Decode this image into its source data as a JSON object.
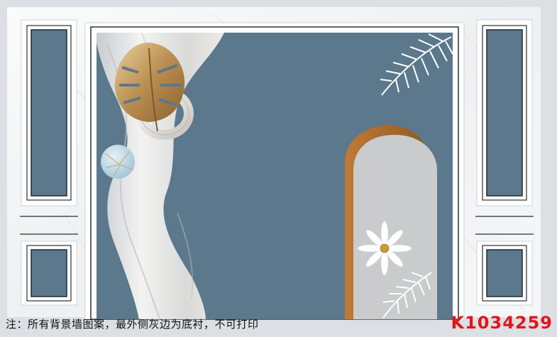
{
  "image": {
    "colors": {
      "background_gray": "#dcdfe3",
      "panel_white": "#f4f5f6",
      "wall_blue": "#5b788c",
      "gold": "#b98c4f",
      "copper_arch": "#b06f2b",
      "arch_inner": "#c9cbcc",
      "white_leaf": "#ffffff",
      "caption_text": "#111111",
      "code_red": "#e0161b"
    },
    "elements": [
      "left-wainscot-panel",
      "center-framed-mural",
      "right-wainscot-panel",
      "silk-drape",
      "gold-monstera-leaf",
      "marble-sphere",
      "ring-ornament",
      "arched-window",
      "white-flower",
      "palm-leaf-top",
      "palm-leaf-bottom"
    ]
  },
  "caption": {
    "note": "注：所有背景墙图案，最外侧灰边为底衬，不可打印",
    "code": "K1034259"
  }
}
